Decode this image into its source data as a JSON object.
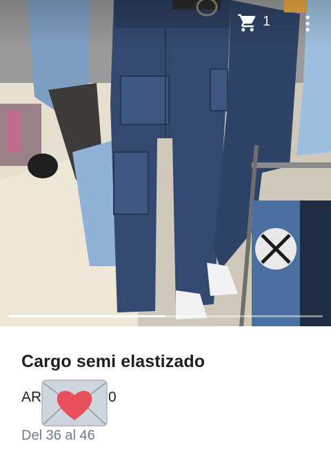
{
  "header": {
    "cart_count": "1",
    "icons": [
      "cart-icon",
      "more-vert-icon"
    ]
  },
  "gallery": {
    "progress": 0.5
  },
  "product": {
    "title": "Cargo semi elastizado",
    "price_prefix": "AR",
    "price_suffix": "0",
    "sizes": "Del 36 al 46"
  },
  "colors": {
    "denim_dark": "#2f4366",
    "denim_mid": "#3e5680",
    "denim_light": "#8fb2d6",
    "heart": "#e8505b",
    "envelope": "#cfd6de",
    "sizes_text": "#6b7b8c"
  }
}
